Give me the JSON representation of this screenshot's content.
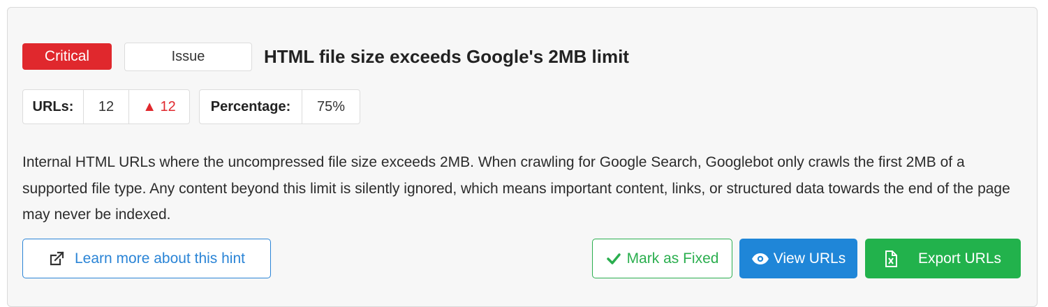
{
  "hint": {
    "severity": "Critical",
    "type": "Issue",
    "title": "HTML file size exceeds Google's 2MB limit",
    "description": "Internal HTML URLs where the uncompressed file size exceeds 2MB. When crawling for Google Search, Googlebot only crawls the first 2MB of a supported file type. Any content beyond this limit is silently ignored, which means important content, links, or structured data towards the end of the page may never be indexed."
  },
  "stats": {
    "urls_label": "URLs:",
    "urls_value": "12",
    "urls_delta": "▲ 12",
    "percentage_label": "Percentage:",
    "percentage_value": "75%"
  },
  "actions": {
    "learn_more": "Learn more about this hint",
    "mark_fixed": "Mark as Fixed",
    "view_urls": "View URLs",
    "export_urls": "Export URLs"
  },
  "colors": {
    "critical": "#e0282d",
    "primary": "#1f86d8",
    "success": "#22b24c"
  },
  "icons": {
    "learn_more": "external-link-icon",
    "mark_fixed": "checkmark-icon",
    "view_urls": "eye-icon",
    "export_urls": "excel-file-icon"
  }
}
